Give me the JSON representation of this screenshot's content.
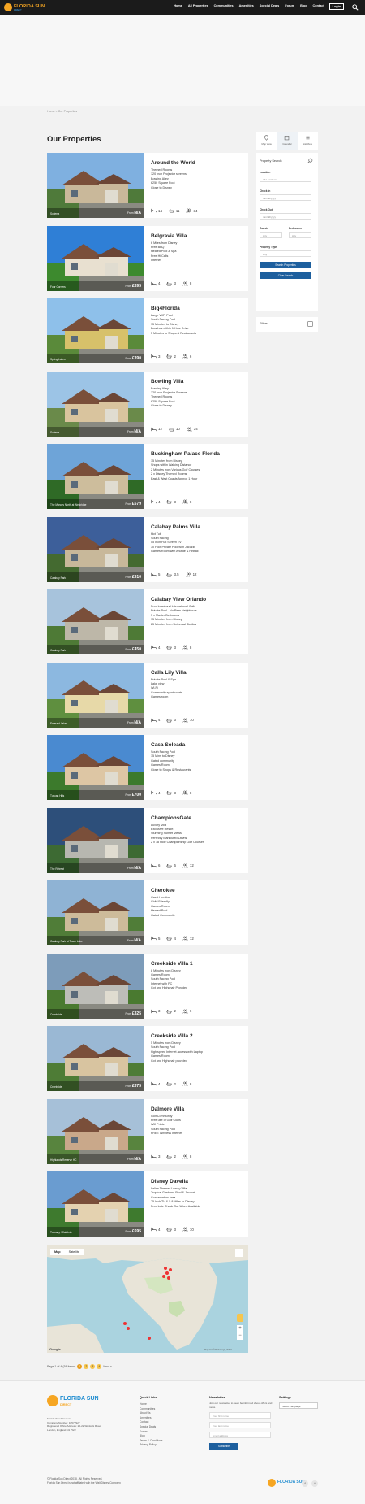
{
  "header": {
    "logo_text": "FLORIDA SUN",
    "logo_sub": "DIRECT",
    "nav": [
      "Home",
      "All Properties",
      "Communities",
      "Amenities",
      "Special Deals",
      "Forum",
      "Blog",
      "Contact",
      "Login"
    ]
  },
  "breadcrumb": "Home > Our Properties",
  "page_title": "Our Properties",
  "from_label": "From",
  "properties": [
    {
      "title": "Around the World",
      "location": "Solterra",
      "price": "N/A",
      "features": [
        "Themed Rooms",
        "120 Inch Projector screens",
        "Bowling Alley",
        "6250 Square Foot",
        "Close to Disney"
      ],
      "bedrooms": "14",
      "bathrooms": "11",
      "sleeps": "34"
    },
    {
      "title": "Belgravia Villa",
      "location": "Four Corners",
      "price": "£395",
      "features": [
        "6 Miles from Disney",
        "Free BBQ",
        "Heated Pool & Spa",
        "Free Hi Calls",
        "Internet"
      ],
      "bedrooms": "4",
      "bathrooms": "3",
      "sleeps": "8"
    },
    {
      "title": "Big4Florida",
      "location": "Spring Lakes",
      "price": "£390",
      "features": [
        "Large WIFI Pool",
        "South Facing Pool",
        "15 Minutes to Disney",
        "Beaches within 1 Hour Drive",
        "5 Minutes to Shops & Restaurants"
      ],
      "bedrooms": "3",
      "bathrooms": "2",
      "sleeps": "6"
    },
    {
      "title": "Bowling Villa",
      "location": "Solterra",
      "price": "N/A",
      "features": [
        "Bowling Alley",
        "120 Inch Projector Screens",
        "Themed Rooms",
        "6250 Square Foot",
        "Close to Disney"
      ],
      "bedrooms": "12",
      "bathrooms": "10",
      "sleeps": "34"
    },
    {
      "title": "Buckingham Palace Florida",
      "location": "The Manors North at Westridge",
      "price": "£679",
      "features": [
        "15 Minutes from Disney",
        "Shops within Walking Distance",
        "2 Minutes from Various Golf Courses",
        "2 x Disney Themed Rooms",
        "East & West Coasts Approx 1 Hour"
      ],
      "bedrooms": "4",
      "bathrooms": "3",
      "sleeps": "8"
    },
    {
      "title": "Calabay Palms Villa",
      "location": "Calabay Park",
      "price": "£910",
      "features": [
        "Hot Tub",
        "South Facing",
        "55 Inch Flat Screen TV",
        "30 Foot Private Pool with Jacuzzi",
        "Games Room with Arcade & Pinball"
      ],
      "bedrooms": "5",
      "bathrooms": "3.5",
      "sleeps": "12"
    },
    {
      "title": "Calabay View Orlando",
      "location": "Calabay Park",
      "price": "£450",
      "features": [
        "Free Local and International Calls",
        "Private Pool - No Rear Neighbours",
        "3 x Master Bedrooms",
        "15 Minutes from Disney",
        "25 Minutes from Universal Studios"
      ],
      "bedrooms": "4",
      "bathrooms": "3",
      "sleeps": "8"
    },
    {
      "title": "Calla Lily Villa",
      "location": "Emerald Lakes",
      "price": "N/A",
      "features": [
        "Private Pool & Spa",
        "Lake view",
        "Wi-Fi",
        "Community sport courts",
        "Games room"
      ],
      "bedrooms": "4",
      "bathrooms": "3",
      "sleeps": "10"
    },
    {
      "title": "Casa Soleada",
      "location": "Tuscan Hills",
      "price": "£700",
      "features": [
        "South Facing Pool",
        "15 Mins to Disney",
        "Gated community",
        "Games Room",
        "Close to Shops & Restaurants"
      ],
      "bedrooms": "4",
      "bathrooms": "3",
      "sleeps": "8"
    },
    {
      "title": "ChampionsGate",
      "location": "The Retreat",
      "price": "N/A",
      "features": [
        "Luxury Villa",
        "Exclusive Resort",
        "Stunning Sunset Views",
        "Perfectly Manicured Lawns",
        "2 x 18 Hole Championship Golf Courses"
      ],
      "bedrooms": "6",
      "bathrooms": "6",
      "sleeps": "12"
    },
    {
      "title": "Cherokee",
      "location": "Calabay Park at Tower Lake",
      "price": "N/A",
      "features": [
        "Great Location",
        "Child Friendly",
        "Games Room",
        "Heated Pool",
        "Gated Community"
      ],
      "bedrooms": "5",
      "bathrooms": "4",
      "sleeps": "12"
    },
    {
      "title": "Creekside Villa 1",
      "location": "Creekside",
      "price": "£325",
      "features": [
        "8 Minutes from Disney",
        "Games Room",
        "South Facing Pool",
        "Internet with PC",
        "Cot and Highchair Provided"
      ],
      "bedrooms": "3",
      "bathrooms": "2",
      "sleeps": "6"
    },
    {
      "title": "Creekside Villa 2",
      "location": "Creekside",
      "price": "£375",
      "features": [
        "5 Minutes from Disney",
        "South Facing Pool",
        "high speed Internet access with Laptop",
        "Games Room",
        "Cot and Highchair provided"
      ],
      "bedrooms": "4",
      "bathrooms": "2",
      "sleeps": "8"
    },
    {
      "title": "Dalmore Villa",
      "location": "Highlands Reserve HC",
      "price": "N/A",
      "features": [
        "Golf Community",
        "Free use of Golf Clubs",
        "Wifi Printer",
        "South Facing Pool",
        "FREE Wireless Internet"
      ],
      "bedrooms": "3",
      "bathrooms": "2",
      "sleeps": "8"
    },
    {
      "title": "Disney Davella",
      "location": "Tuscany / Calabria",
      "price": "£695",
      "features": [
        "Italian Themed Luxury Villa",
        "Tropical Gardens, Pool & Jacuzzi",
        "Conservation Area",
        "75 Inch TV & 5.8 Miles to Disney",
        "Free Late Check Out When Available"
      ],
      "bedrooms": "4",
      "bathrooms": "3",
      "sleeps": "10"
    }
  ],
  "sidebar": {
    "tabs": [
      "Map View",
      "Calendar",
      "List View"
    ],
    "panel_title": "Property Search",
    "location_label": "Location",
    "location_value": "All Locations",
    "checkin_label": "Check In",
    "checkin_placeholder": "mm/dd/yyyy",
    "checkout_label": "Check Out",
    "checkout_placeholder": "mm/dd/yyyy",
    "guests_label": "Guests",
    "guests_value": "Any",
    "bedrooms_label": "Bedrooms",
    "bedrooms_value": "Any",
    "type_label": "Property Type",
    "type_value": "Any",
    "search_btn": "Search Properties",
    "clear_btn": "Clear Search",
    "filters_title": "Filters"
  },
  "map": {
    "tab_map": "Map",
    "tab_satellite": "Satellite",
    "attribution": "Map data ©2018 Google, INEGI",
    "google": "Google"
  },
  "pager": {
    "text": "Page 1 of 4 (58 items)",
    "pages": [
      "1",
      "2",
      "3",
      "4"
    ],
    "next": "Next »"
  },
  "footer": {
    "company_lines": [
      "Florida Sun Direct Ltd.",
      "Company Number: 10577927",
      "Registered Office Address: 20-22 Wenlock Road,",
      "London, England N1 7GU"
    ],
    "quick_title": "Quick Links",
    "quick_links": [
      "Home",
      "Communities",
      "About Us",
      "Amenities",
      "Contact",
      "Special Deals",
      "Forum",
      "Blog",
      "Terms & Conditions",
      "Privacy Policy"
    ],
    "news_title": "Newsletter",
    "news_text": "Join our newsletter to keep be informed about offers and news.",
    "first_name_ph": "Your first name",
    "last_name_ph": "Your last name",
    "email_ph": "Email address",
    "subscribe": "Subscribe",
    "settings_title": "Settings",
    "language": "Select Language",
    "copyright": "© Florida Sun Direct 2018 - All Rights Reserved.",
    "disclaimer": "Florida Sun Direct is not affiliated with the Walt Disney Company",
    "social": [
      "f",
      "t"
    ]
  },
  "colors": {
    "accent": "#1d5f9e",
    "brand_orange": "#f6a623",
    "topbar": "#1b1b1b"
  }
}
